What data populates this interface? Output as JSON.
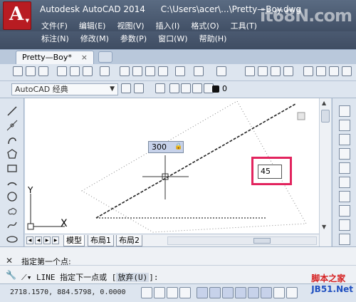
{
  "window": {
    "app_title": "Autodesk AutoCAD 2014",
    "file_path": "C:\\Users\\acer\\...\\Pretty—Boy.dwg"
  },
  "menu": [
    {
      "label": "文件(F)"
    },
    {
      "label": "编辑(E)"
    },
    {
      "label": "视图(V)"
    },
    {
      "label": "插入(I)"
    },
    {
      "label": "格式(O)"
    },
    {
      "label": "工具(T)"
    }
  ],
  "menu2": [
    {
      "label": "标注(N)"
    },
    {
      "label": "修改(M)"
    },
    {
      "label": "参数(P)"
    },
    {
      "label": "窗口(W)"
    },
    {
      "label": "帮助(H)"
    }
  ],
  "watermark": "it68N.com",
  "tabs": {
    "doc_tab": "Pretty—Boy*",
    "close": "×"
  },
  "workspace": {
    "selected": "AutoCAD 经典"
  },
  "layer": {
    "value": "0"
  },
  "canvas": {
    "ucs_y": "Y",
    "ucs_x": "X",
    "length_input": "300",
    "angle_input": "45"
  },
  "layout_tabs": [
    {
      "label": "模型"
    },
    {
      "label": "布局1"
    },
    {
      "label": "布局2"
    }
  ],
  "command": {
    "line1": "指定第一个点:",
    "line2_cmd": "LINE",
    "line2_prompt": "指定下一点或 [",
    "line2_option": "放弃(U)",
    "line2_end": "]:"
  },
  "status": {
    "coords": "2718.1570,  884.5798,  0.0000"
  },
  "footer_watermark": {
    "red": "脚本之家",
    "blue": "JB51.Net"
  },
  "colors": {
    "title_bg": "#4b5a71",
    "app_button": "#b81c22",
    "highlight_box": "#e2245e",
    "toolbar_bg": "#dde5ef"
  }
}
